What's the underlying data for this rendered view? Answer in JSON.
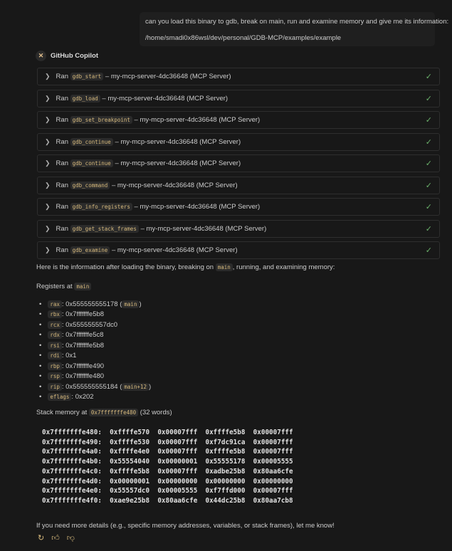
{
  "user_message": {
    "line1": "can you load this binary to gdb, break on main, run and examine memory and give me its information:",
    "line2": "/home/smadi0x86wsl/dev/personal/GDB-MCP/examples/example"
  },
  "assistant": {
    "name": "GitHub Copilot"
  },
  "tool_calls": [
    {
      "prefix": "Ran",
      "tool": "gdb_start",
      "suffix": "– my-mcp-server-4dc36648 (MCP Server)"
    },
    {
      "prefix": "Ran",
      "tool": "gdb_load",
      "suffix": "– my-mcp-server-4dc36648 (MCP Server)"
    },
    {
      "prefix": "Ran",
      "tool": "gdb_set_breakpoint",
      "suffix": "– my-mcp-server-4dc36648 (MCP Server)"
    },
    {
      "prefix": "Ran",
      "tool": "gdb_continue",
      "suffix": "– my-mcp-server-4dc36648 (MCP Server)"
    },
    {
      "prefix": "Ran",
      "tool": "gdb_continue",
      "suffix": "– my-mcp-server-4dc36648 (MCP Server)"
    },
    {
      "prefix": "Ran",
      "tool": "gdb_command",
      "suffix": "– my-mcp-server-4dc36648 (MCP Server)"
    },
    {
      "prefix": "Ran",
      "tool": "gdb_info_registers",
      "suffix": "– my-mcp-server-4dc36648 (MCP Server)"
    },
    {
      "prefix": "Ran",
      "tool": "gdb_get_stack_frames",
      "suffix": "– my-mcp-server-4dc36648 (MCP Server)"
    },
    {
      "prefix": "Ran",
      "tool": "gdb_examine",
      "suffix": "– my-mcp-server-4dc36648 (MCP Server)"
    }
  ],
  "intro": {
    "before": "Here is the information after loading the binary, breaking on ",
    "code": "main",
    "after": ", running, and examining memory:"
  },
  "registers_heading": {
    "text": "Registers at ",
    "code": "main"
  },
  "registers": [
    {
      "name": "rax",
      "value": ": 0x555555555178 (",
      "note": "main",
      "close": ")"
    },
    {
      "name": "rbx",
      "value": ": 0x7fffffffe5b8"
    },
    {
      "name": "rcx",
      "value": ": 0x555555557dc0"
    },
    {
      "name": "rdx",
      "value": ": 0x7fffffffe5c8"
    },
    {
      "name": "rsi",
      "value": ": 0x7fffffffe5b8"
    },
    {
      "name": "rdi",
      "value": ": 0x1"
    },
    {
      "name": "rbp",
      "value": ": 0x7fffffffe490"
    },
    {
      "name": "rsp",
      "value": ": 0x7fffffffe480"
    },
    {
      "name": "rip",
      "value": ": 0x555555555184 (",
      "note": "main+12",
      "close": ")"
    },
    {
      "name": "eflags",
      "value": ": 0x202"
    }
  ],
  "stack_heading": {
    "text": "Stack memory at ",
    "code": "0x7fffffffe480",
    "after": " (32 words)"
  },
  "memory_dump": "0x7fffffffe480:  0xffffe570  0x00007fff  0xffffe5b8  0x00007fff\n0x7fffffffe490:  0xffffe530  0x00007fff  0xf7dc91ca  0x00007fff\n0x7fffffffe4a0:  0xffffe4e0  0x00007fff  0xffffe5b8  0x00007fff\n0x7fffffffe4b0:  0x55554040  0x00000001  0x55555178  0x00005555\n0x7fffffffe4c0:  0xffffe5b8  0x00007fff  0xadbe25b8  0x80aa6cfe\n0x7fffffffe4d0:  0x00000001  0x00000000  0x00000000  0x00000000\n0x7fffffffe4e0:  0x55557dc0  0x00005555  0xf7ffd000  0x00007fff\n0x7fffffffe4f0:  0xae9e25b8  0x80aa6cfe  0x44dc25b8  0x80aa7cb8",
  "closing": "If you need more details (e.g., specific memory addresses, variables, or stack frames), let me know!"
}
